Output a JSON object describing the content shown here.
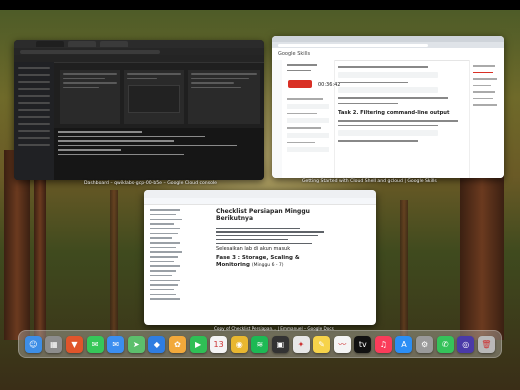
{
  "windows": {
    "console": {
      "caption": "Dashboard – qwiklabs-gcp-00-b5e – Google Cloud console"
    },
    "skills": {
      "caption": "Getting Started with Cloud Shell and gcloud | Google Skills",
      "logo": "Google Skills",
      "timer": "00:36:42",
      "heading_text": "Task 2. Filtering command-line output"
    },
    "docs": {
      "caption": "Copy of Checklist Persiapan... | Emmanuel – Google Docs",
      "doc_title": "Checklist Persiapan Minggu Berikutnya",
      "doc_subheading": "Selesaikan lab di akun masuk",
      "doc_section": "Fase 3 : Storage, Scaling & Monitoring",
      "doc_section_suffix": "(Minggu 6 - 7)"
    }
  },
  "dock": {
    "apps": [
      {
        "icon": "finder-icon",
        "glyph": "☺",
        "color": "#3d8ee6"
      },
      {
        "icon": "launchpad-icon",
        "glyph": "▦",
        "color": "#8d8d8d"
      },
      {
        "icon": "brave-icon",
        "glyph": "▼",
        "color": "#e0552b"
      },
      {
        "icon": "messages-icon",
        "glyph": "✉",
        "color": "#36c759"
      },
      {
        "icon": "mail-icon",
        "glyph": "✉",
        "color": "#3b8ef0"
      },
      {
        "icon": "maps-icon",
        "glyph": "➤",
        "color": "#5cbf6c"
      },
      {
        "icon": "finder-alt-icon",
        "glyph": "◆",
        "color": "#2f7de1"
      },
      {
        "icon": "photos-icon",
        "glyph": "✿",
        "color": "#f2a93b"
      },
      {
        "icon": "facetime-icon",
        "glyph": "▶",
        "color": "#2fbf55"
      },
      {
        "icon": "calendar-icon",
        "glyph": "13",
        "color": "#f4f4f4"
      },
      {
        "icon": "chrome-icon",
        "glyph": "◉",
        "color": "#e8b730"
      },
      {
        "icon": "spotify-icon",
        "glyph": "≋",
        "color": "#1db954"
      },
      {
        "icon": "tv-icon",
        "glyph": "▣",
        "color": "#333333"
      },
      {
        "icon": "tool-icon",
        "glyph": "✦",
        "color": "#e7e7e7"
      },
      {
        "icon": "notes-icon",
        "glyph": "✎",
        "color": "#f6d34a"
      },
      {
        "icon": "freeform-icon",
        "glyph": "〰",
        "color": "#f4f4f4"
      },
      {
        "icon": "apple-tv-icon",
        "glyph": "tv",
        "color": "#111111"
      },
      {
        "icon": "music-icon",
        "glyph": "♫",
        "color": "#fa3c5a"
      },
      {
        "icon": "app-store-icon",
        "glyph": "A",
        "color": "#2b8ef5"
      },
      {
        "icon": "settings-icon",
        "glyph": "⚙",
        "color": "#9a9a9a"
      },
      {
        "icon": "whatsapp-icon",
        "glyph": "✆",
        "color": "#35c25a"
      },
      {
        "icon": "screen-share-icon",
        "glyph": "◎",
        "color": "#4a3aa8"
      },
      {
        "icon": "trash-icon",
        "glyph": "🗑",
        "color": "#b9b9b9"
      }
    ]
  }
}
